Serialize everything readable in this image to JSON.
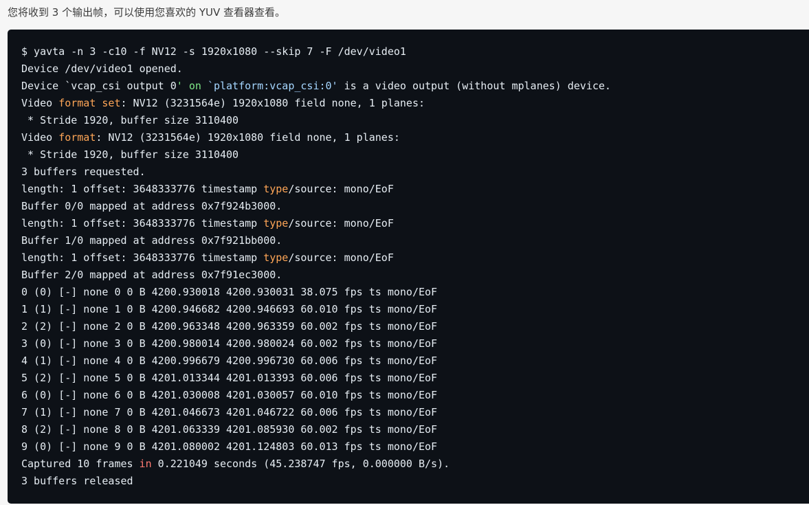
{
  "intro_text": "您将收到 3 个输出帧，可以使用您喜欢的 YUV 查看器查看。",
  "colors": {
    "page_bg": "#f6f6f6",
    "code_bg": "#0d1117",
    "code_text": "#e6edf3",
    "highlight_orange": "#ffa657",
    "highlight_green": "#7ee787",
    "highlight_red": "#ff7b72"
  },
  "code_lines": [
    [
      {
        "t": "$ yavta -n 3 -c10 -f NV12 -s 1920x1080 --skip 7 -F /dev/video1"
      }
    ],
    [
      {
        "t": "Device /dev/video1 opened."
      }
    ],
    [
      {
        "t": "Device `vcap_csi output 0"
      },
      {
        "t": "' on ",
        "c": "green"
      },
      {
        "t": "`platform:vcap_csi:0'",
        "c": "string"
      },
      {
        "t": " is a video output (without mplanes) device."
      }
    ],
    [
      {
        "t": "Video "
      },
      {
        "t": "format",
        "c": "orange"
      },
      {
        "t": " "
      },
      {
        "t": "set",
        "c": "orange"
      },
      {
        "t": ": NV12 (3231564e) 1920x1080 field none, 1 planes:"
      }
    ],
    [
      {
        "t": " * Stride 1920, buffer size 3110400"
      }
    ],
    [
      {
        "t": "Video "
      },
      {
        "t": "format",
        "c": "orange"
      },
      {
        "t": ": NV12 (3231564e) 1920x1080 field none, 1 planes:"
      }
    ],
    [
      {
        "t": " * Stride 1920, buffer size 3110400"
      }
    ],
    [
      {
        "t": "3 buffers requested."
      }
    ],
    [
      {
        "t": "length: 1 offset: 3648333776 timestamp "
      },
      {
        "t": "type",
        "c": "orange"
      },
      {
        "t": "/source: mono/EoF"
      }
    ],
    [
      {
        "t": "Buffer 0/0 mapped at address 0x7f924b3000."
      }
    ],
    [
      {
        "t": "length: 1 offset: 3648333776 timestamp "
      },
      {
        "t": "type",
        "c": "orange"
      },
      {
        "t": "/source: mono/EoF"
      }
    ],
    [
      {
        "t": "Buffer 1/0 mapped at address 0x7f921bb000."
      }
    ],
    [
      {
        "t": "length: 1 offset: 3648333776 timestamp "
      },
      {
        "t": "type",
        "c": "orange"
      },
      {
        "t": "/source: mono/EoF"
      }
    ],
    [
      {
        "t": "Buffer 2/0 mapped at address 0x7f91ec3000."
      }
    ],
    [
      {
        "t": "0 (0) [-] none 0 0 B 4200.930018 4200.930031 38.075 fps ts mono/EoF"
      }
    ],
    [
      {
        "t": "1 (1) [-] none 1 0 B 4200.946682 4200.946693 60.010 fps ts mono/EoF"
      }
    ],
    [
      {
        "t": "2 (2) [-] none 2 0 B 4200.963348 4200.963359 60.002 fps ts mono/EoF"
      }
    ],
    [
      {
        "t": "3 (0) [-] none 3 0 B 4200.980014 4200.980024 60.002 fps ts mono/EoF"
      }
    ],
    [
      {
        "t": "4 (1) [-] none 4 0 B 4200.996679 4200.996730 60.006 fps ts mono/EoF"
      }
    ],
    [
      {
        "t": "5 (2) [-] none 5 0 B 4201.013344 4201.013393 60.006 fps ts mono/EoF"
      }
    ],
    [
      {
        "t": "6 (0) [-] none 6 0 B 4201.030008 4201.030057 60.010 fps ts mono/EoF"
      }
    ],
    [
      {
        "t": "7 (1) [-] none 7 0 B 4201.046673 4201.046722 60.006 fps ts mono/EoF"
      }
    ],
    [
      {
        "t": "8 (2) [-] none 8 0 B 4201.063339 4201.085930 60.002 fps ts mono/EoF"
      }
    ],
    [
      {
        "t": "9 (0) [-] none 9 0 B 4201.080002 4201.124803 60.013 fps ts mono/EoF"
      }
    ],
    [
      {
        "t": "Captured 10 frames "
      },
      {
        "t": "in",
        "c": "red"
      },
      {
        "t": " 0.221049 seconds (45.238747 fps, 0.000000 B/s)."
      }
    ],
    [
      {
        "t": "3 buffers released"
      }
    ]
  ]
}
